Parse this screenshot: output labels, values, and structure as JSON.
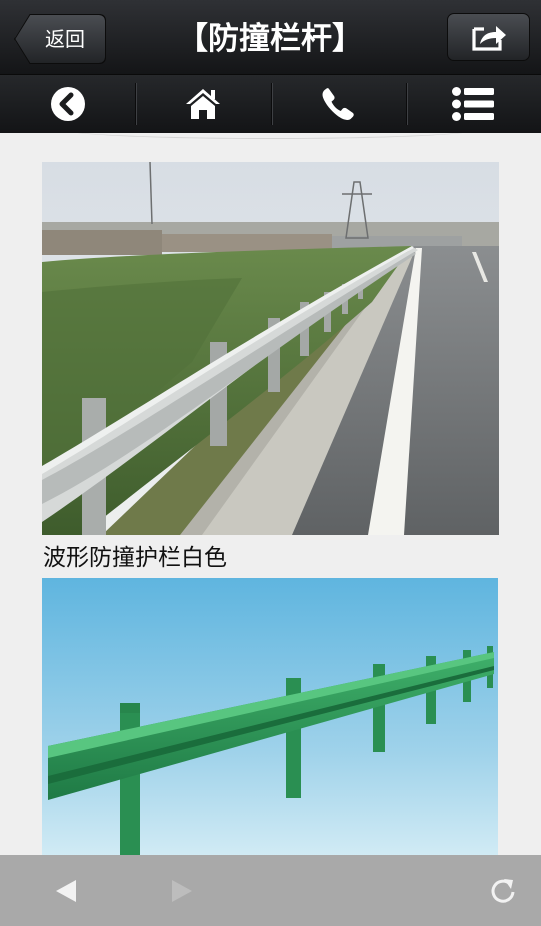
{
  "header": {
    "back_label": "返回",
    "title": "【防撞栏杆】"
  },
  "nav": {
    "items": [
      "back-circle-icon",
      "home-icon",
      "phone-icon",
      "menu-list-icon"
    ]
  },
  "content": {
    "caption_1": "波形防撞护栏白色"
  },
  "bottombar": {
    "icons": [
      "prev-arrow-icon",
      "next-arrow-icon",
      "refresh-icon"
    ]
  },
  "colors": {
    "header_top": "#2f3135",
    "header_bottom": "#141517",
    "page_bg": "#efefef",
    "bottom_bar": "#a9a9a9",
    "guardrail_green": "#2b9a55",
    "sky_blue": "#5fb5df"
  }
}
